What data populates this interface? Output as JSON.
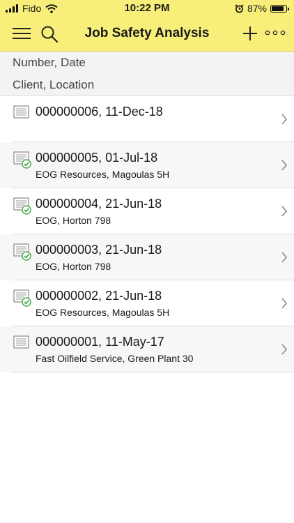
{
  "status_bar": {
    "carrier": "Fido",
    "time": "10:22 PM",
    "battery": "87%",
    "battery_level": 0.87
  },
  "navbar": {
    "title": "Job Safety Analysis",
    "left_icons": [
      "menu-icon",
      "search-icon"
    ],
    "right_icons": [
      "plus-icon",
      "more-icon"
    ]
  },
  "header": {
    "line1": "Number, Date",
    "line2": "Client, Location"
  },
  "list": {
    "items": [
      {
        "title": "000000006, 11-Dec-18",
        "subtitle": "",
        "icon": "document-icon",
        "completed": false
      },
      {
        "title": "000000005, 01-Jul-18",
        "subtitle": "EOG Resources, Magoulas 5H",
        "icon": "document-check-icon",
        "completed": true
      },
      {
        "title": "000000004, 21-Jun-18",
        "subtitle": "EOG, Horton 798",
        "icon": "document-check-icon",
        "completed": true
      },
      {
        "title": "000000003, 21-Jun-18",
        "subtitle": "EOG, Horton 798",
        "icon": "document-check-icon",
        "completed": true
      },
      {
        "title": "000000002, 21-Jun-18",
        "subtitle": "EOG Resources, Magoulas 5H",
        "icon": "document-check-icon",
        "completed": true
      },
      {
        "title": "000000001, 11-May-17",
        "subtitle": "Fast Oilfield Service, Green Plant 30",
        "icon": "document-icon",
        "completed": false
      }
    ]
  },
  "colors": {
    "topbar": "#f8ee7a",
    "check": "#43a84b"
  }
}
